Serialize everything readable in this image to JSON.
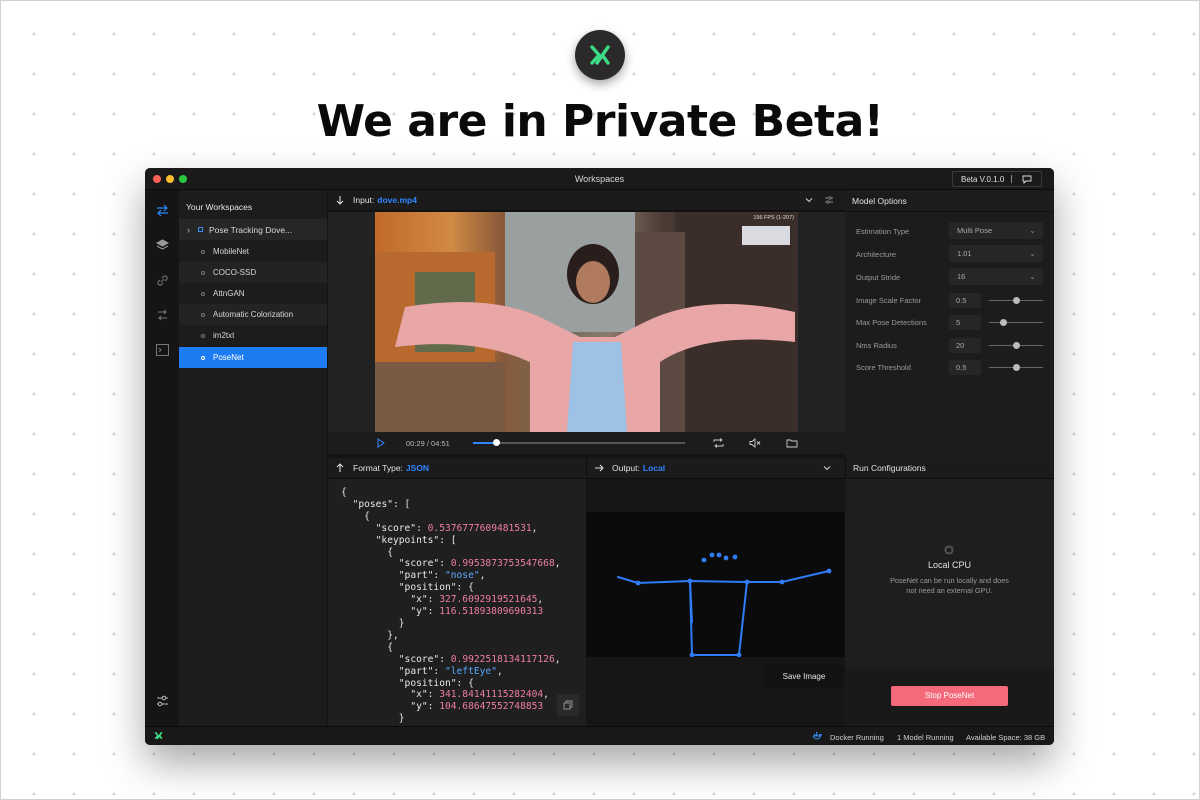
{
  "headline": "We are in Private Beta!",
  "window": {
    "title": "Workspaces",
    "version": "Beta V.0.1.0"
  },
  "sidebar": {
    "title": "Your Workspaces",
    "parent_item": "Pose Tracking Dove...",
    "items": [
      {
        "label": "MobileNet"
      },
      {
        "label": "COCO-SSD"
      },
      {
        "label": "AttnGAN"
      },
      {
        "label": "Automatic Colorization"
      },
      {
        "label": "im2txt"
      },
      {
        "label": "PoseNet",
        "selected": true
      }
    ]
  },
  "input": {
    "label": "Input:",
    "file": "dove.mp4",
    "fps": "196 FPS (1-207)"
  },
  "player": {
    "time": "00:29 / 04:51",
    "progress": 0.11
  },
  "model_options": {
    "title": "Model Options",
    "selects": [
      {
        "label": "Estimation Type",
        "value": "Multi Pose"
      },
      {
        "label": "Architecture",
        "value": "1.01"
      },
      {
        "label": "Output Stride",
        "value": "16"
      }
    ],
    "sliders": [
      {
        "label": "Image Scale Factor",
        "value": "0.5",
        "level": 0.5
      },
      {
        "label": "Max Pose Detections",
        "value": "5",
        "level": 0.25
      },
      {
        "label": "Nms Radius",
        "value": "20",
        "level": 0.5
      },
      {
        "label": "Score Threshold",
        "value": "0.5",
        "level": 0.5
      }
    ]
  },
  "format": {
    "label": "Format Type:",
    "value": "JSON"
  },
  "output": {
    "label": "Output:",
    "value": "Local",
    "save_label": "Save Image"
  },
  "run": {
    "title": "Run Configurations",
    "mode": "Local CPU",
    "description": "PoseNet can be run locally and does not need an external GPU.",
    "stop_label": "Stop PoseNet"
  },
  "json_view": {
    "poses_key": "\"poses\"",
    "score_key": "\"score\"",
    "keypoints_key": "\"keypoints\"",
    "part_key": "\"part\"",
    "position_key": "\"position\"",
    "x_key": "\"x\"",
    "y_key": "\"y\"",
    "pose_score": "0.5376777609481531",
    "kp1_score": "0.9953873753547668",
    "kp1_part": "\"nose\"",
    "kp1_x": "327.6092919521645",
    "kp1_y": "116.51893809690313",
    "kp2_score": "0.9922518134117126",
    "kp2_part": "\"leftEye\"",
    "kp2_x": "341.84141115282404",
    "kp2_y": "104.68647552748853"
  },
  "status": {
    "docker": "Docker Running",
    "models": "1 Model Running",
    "space": "Available Space: 38 GB"
  },
  "colors": {
    "accent": "#2f86ff",
    "selected": "#1d7cf2",
    "stop_button": "#f56a7a",
    "skeleton": "#2f7cf6"
  }
}
